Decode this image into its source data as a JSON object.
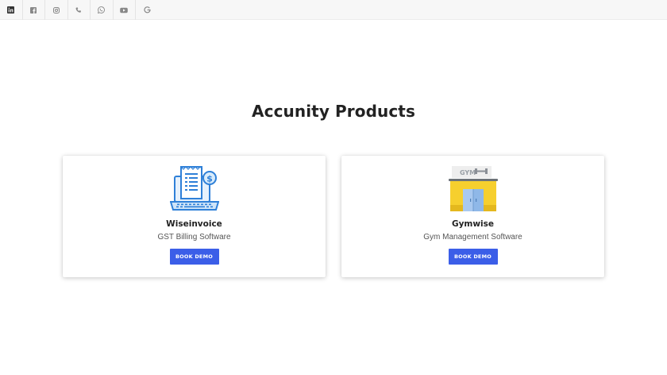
{
  "topbar": {
    "icons": [
      "linkedin-icon",
      "facebook-icon",
      "instagram-icon",
      "phone-icon",
      "whatsapp-icon",
      "youtube-icon",
      "google-icon"
    ]
  },
  "section": {
    "title": "Accunity Products"
  },
  "products": [
    {
      "name": "Wiseinvoice",
      "description": "GST Billing Software",
      "button": "BOOK DEMO",
      "icon": "laptop-invoice-icon",
      "accent": "#2f80d8"
    },
    {
      "name": "Gymwise",
      "description": "Gym Management Software",
      "button": "BOOK DEMO",
      "icon": "gym-building-icon",
      "logo_text": "GYM",
      "accent": "#f6cf2e"
    }
  ],
  "colors": {
    "button": "#3b5ee8",
    "topbar": "#f7f7f7",
    "icon_gray": "#888888"
  }
}
